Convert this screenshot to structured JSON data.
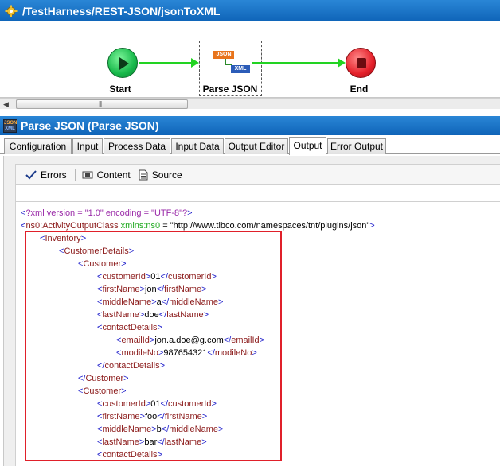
{
  "window": {
    "title": "/TestHarness/REST-JSON/jsonToXML",
    "icon": "gear-icon"
  },
  "canvas": {
    "nodes": [
      {
        "id": "start",
        "label": "Start",
        "icon": "play-icon"
      },
      {
        "id": "parse",
        "label": "Parse JSON",
        "icon": "json-to-xml-icon",
        "badge_json": "JSON",
        "badge_xml": "XML"
      },
      {
        "id": "end",
        "label": "End",
        "icon": "stop-icon"
      }
    ]
  },
  "scrollbar": {
    "grip": "|||"
  },
  "panel": {
    "title": "Parse JSON (Parse JSON)",
    "icon_top": "JSON",
    "icon_bottom": "XML"
  },
  "tabs": [
    {
      "label": "Configuration",
      "active": false
    },
    {
      "label": "Input",
      "active": false
    },
    {
      "label": "Process Data",
      "active": false
    },
    {
      "label": "Input Data",
      "active": false
    },
    {
      "label": "Output Editor",
      "active": false
    },
    {
      "label": "Output",
      "active": true
    },
    {
      "label": "Error Output",
      "active": false
    }
  ],
  "toolbar": {
    "errors_label": "Errors",
    "content_label": "Content",
    "source_label": "Source"
  },
  "colors": {
    "accent_blue": "#1a73c8",
    "highlight_red": "#e0202a",
    "start_green": "#17b84a",
    "end_red": "#e5202a"
  },
  "xml": {
    "declaration": "?xml version = \"1.0\" encoding = \"UTF-8\"?",
    "root_tag": "ns0:ActivityOutputClass",
    "root_attr_name": "xmlns:ns0",
    "root_attr_value": "\"http://www.tibco.com/namespaces/tnt/plugins/json\"",
    "lines": [
      {
        "indent": 1,
        "open": "Inventory"
      },
      {
        "indent": 2,
        "open": "CustomerDetails"
      },
      {
        "indent": 3,
        "open": "Customer"
      },
      {
        "indent": 4,
        "open": "customerId",
        "text": "01",
        "close": "customerId"
      },
      {
        "indent": 4,
        "open": "firstName",
        "text": "jon",
        "close": "firstName"
      },
      {
        "indent": 4,
        "open": "middleName",
        "text": "a",
        "close": "middleName"
      },
      {
        "indent": 4,
        "open": "lastName",
        "text": "doe",
        "close": "lastName"
      },
      {
        "indent": 4,
        "open": "contactDetails"
      },
      {
        "indent": 5,
        "open": "emailId",
        "text": "jon.a.doe@g.com",
        "close": "emailId"
      },
      {
        "indent": 5,
        "open": "modileNo",
        "text": "987654321",
        "close": "modileNo"
      },
      {
        "indent": 4,
        "close": "contactDetails"
      },
      {
        "indent": 3,
        "close": "Customer"
      },
      {
        "indent": 3,
        "open": "Customer"
      },
      {
        "indent": 4,
        "open": "customerId",
        "text": "01",
        "close": "customerId"
      },
      {
        "indent": 4,
        "open": "firstName",
        "text": "foo",
        "close": "firstName"
      },
      {
        "indent": 4,
        "open": "middleName",
        "text": "b",
        "close": "middleName"
      },
      {
        "indent": 4,
        "open": "lastName",
        "text": "bar",
        "close": "lastName"
      },
      {
        "indent": 4,
        "open": "contactDetails"
      }
    ]
  }
}
